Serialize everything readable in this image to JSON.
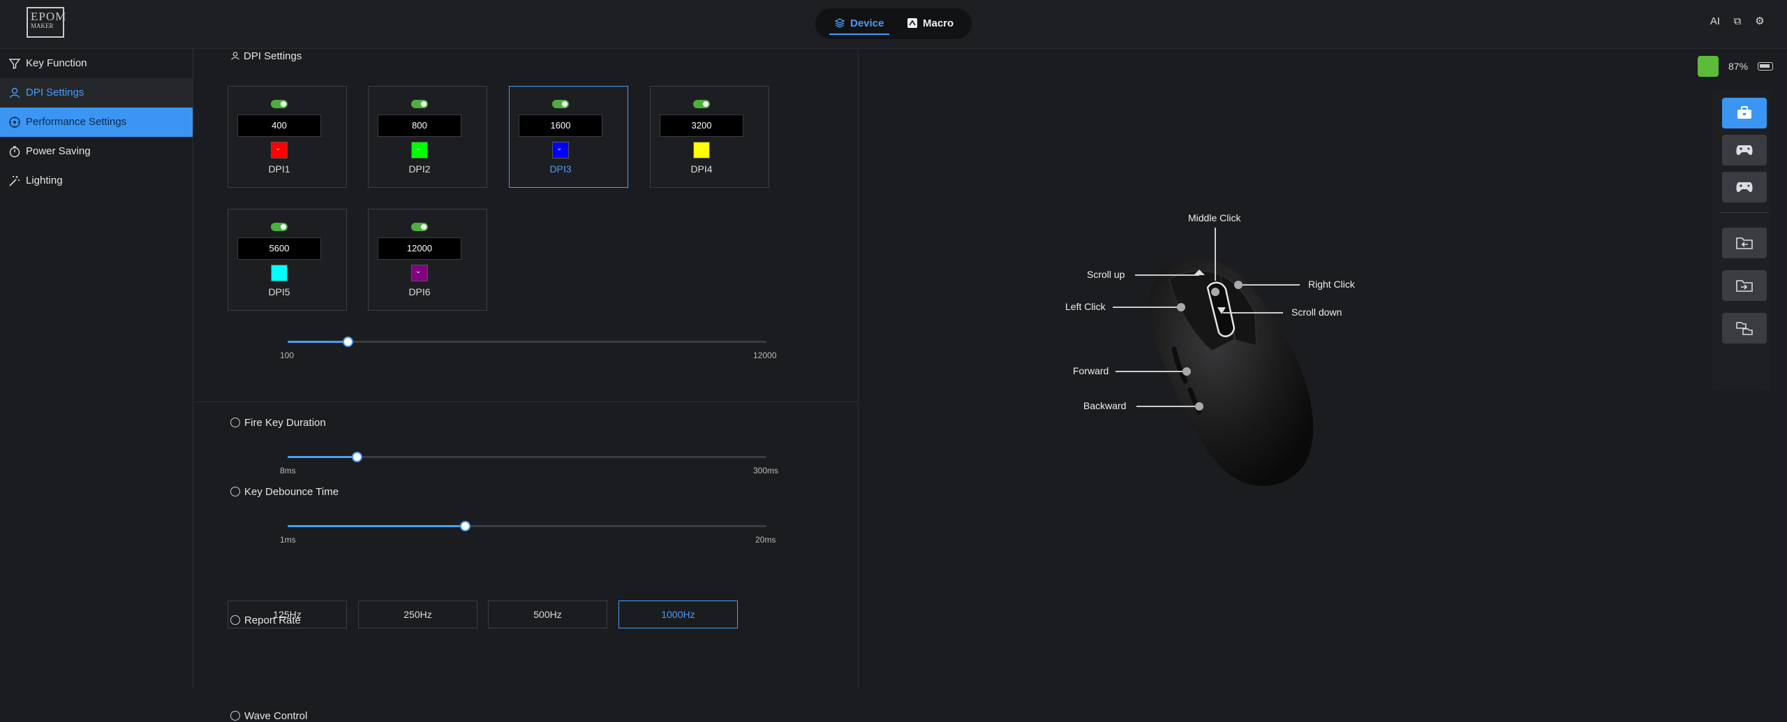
{
  "header": {
    "logo": {
      "top": "EPOM",
      "bottom": "MAKER"
    },
    "tabs": [
      {
        "label": "Device",
        "icon": "layers-icon"
      },
      {
        "label": "Macro",
        "icon": "macro-icon"
      }
    ],
    "right_icons": [
      "ai-icon",
      "window-icon",
      "gear-icon"
    ],
    "ai_text": "AI"
  },
  "sidebar": {
    "items": [
      {
        "label": "Key Function",
        "icon": "filter-icon"
      },
      {
        "label": "DPI Settings",
        "icon": "user-icon"
      },
      {
        "label": "Performance Settings",
        "icon": "gauge-icon"
      },
      {
        "label": "Power Saving",
        "icon": "clock-icon"
      },
      {
        "label": "Lighting",
        "icon": "wand-icon"
      }
    ]
  },
  "dpi_settings": {
    "title": "DPI Settings",
    "stages": [
      {
        "name": "DPI1",
        "value": "400",
        "color": "#ff0000",
        "enabled": true
      },
      {
        "name": "DPI2",
        "value": "800",
        "color": "#00ff00",
        "enabled": true
      },
      {
        "name": "DPI3",
        "value": "1600",
        "color": "#0000ff",
        "enabled": true,
        "selected": true
      },
      {
        "name": "DPI4",
        "value": "3200",
        "color": "#ffff00",
        "enabled": true
      },
      {
        "name": "DPI5",
        "value": "5600",
        "color": "#00ffff",
        "enabled": true
      },
      {
        "name": "DPI6",
        "value": "12000",
        "color": "#800080",
        "enabled": true
      }
    ],
    "slider": {
      "min_label": "100",
      "max_label": "12000",
      "level": 0.125
    }
  },
  "performance": {
    "fire_key": {
      "title": "Fire Key Duration",
      "min_label": "8ms",
      "max_label": "300ms",
      "level": 0.145
    },
    "debounce": {
      "title": "Key Debounce Time",
      "min_label": "1ms",
      "max_label": "20ms",
      "level": 0.37
    },
    "report_rate": {
      "title": "Report Rate",
      "options": [
        "125Hz",
        "250Hz",
        "500Hz",
        "1000Hz"
      ],
      "selected": "1000Hz"
    },
    "wave_control": {
      "title": "Wave Control"
    }
  },
  "status": {
    "battery": "87%"
  },
  "mouse_labels": {
    "middle": "Middle Click",
    "scroll_up": "Scroll up",
    "right": "Right Click",
    "left": "Left Click",
    "scroll_down": "Scroll down",
    "forward": "Forward",
    "backward": "Backward"
  },
  "right_toolbar": [
    "briefcase-icon",
    "gamepad-icon",
    "gamepad-icon",
    "folder-import-icon",
    "folder-export-icon",
    "folder-sync-icon"
  ],
  "colors": {
    "accent": "#3a96f2",
    "toggle_on": "#4caf3e",
    "background": "#1b1c1f"
  }
}
